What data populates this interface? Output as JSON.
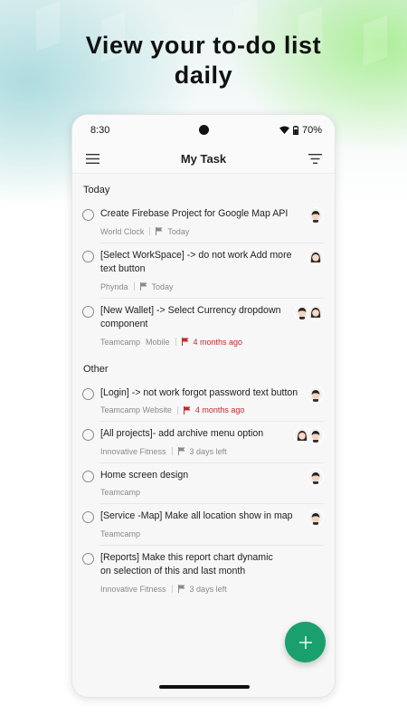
{
  "headline": {
    "line1": "View your to-do list",
    "line2": "daily"
  },
  "status_bar": {
    "time": "8:30",
    "battery": "70%"
  },
  "app_bar": {
    "title": "My Task"
  },
  "sections": {
    "today": "Today",
    "other": "Other"
  },
  "today_tasks": [
    {
      "title": "Create Firebase Project for Google Map API",
      "project": "World Clock",
      "due": "Today",
      "due_red": false,
      "avatars": [
        "boy-avatar"
      ]
    },
    {
      "title": "[Select WorkSpace] -> do not work Add more text button",
      "project": "Phynda",
      "due": "Today",
      "due_red": false,
      "avatars": [
        "girl-avatar"
      ]
    },
    {
      "title": "[New Wallet] -> Select Currency dropdown component",
      "project": "Teamcamp",
      "project_tag": "Mobile",
      "due": "4 months ago",
      "due_red": true,
      "avatars": [
        "boy-avatar",
        "girl-avatar"
      ]
    }
  ],
  "other_tasks": [
    {
      "title": "[Login] -> not work forgot password text button",
      "project": "Teamcamp Website",
      "due": "4 months ago",
      "due_red": true,
      "avatars": [
        "boy-avatar"
      ]
    },
    {
      "title": "[All projects]- add archive menu option",
      "project": "Innovative Fitness",
      "due": "3 days left",
      "due_red": false,
      "avatars": [
        "girl-avatar",
        "boy-avatar"
      ]
    },
    {
      "title": "Home screen design",
      "project": "Teamcamp",
      "avatars": [
        "boy-avatar"
      ]
    },
    {
      "title": "[Service -Map] Make all location show in map",
      "project": "Teamcamp",
      "avatars": [
        "boy-avatar"
      ]
    },
    {
      "title": "[Reports] Make this report chart dynamic on selection of this and last month",
      "project": "Innovative Fitness",
      "due": "3 days left",
      "due_red": false,
      "avatars": []
    }
  ],
  "colors": {
    "accent": "#1aa06c",
    "overdue": "#c1292e"
  },
  "icons": [
    "menu-icon",
    "filter-icon",
    "wifi-icon",
    "battery-icon",
    "flag-icon",
    "plus-icon"
  ]
}
